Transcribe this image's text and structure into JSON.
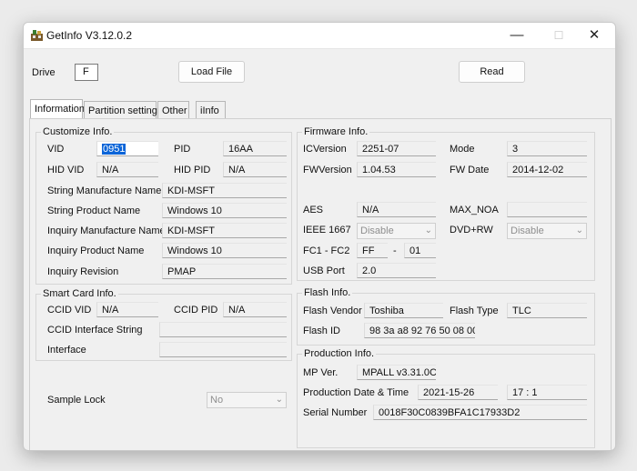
{
  "window": {
    "title": "GetInfo V3.12.0.2",
    "minimize": "—",
    "maximize": "☐",
    "close": "✕"
  },
  "toolbar": {
    "drive_label": "Drive",
    "drive_value": "F",
    "load_file": "Load File",
    "read": "Read"
  },
  "tabs": [
    "Information",
    "Partition setting",
    "Other",
    "iInfo"
  ],
  "customize": {
    "title": "Customize Info.",
    "vid_label": "VID",
    "vid_value": "0951",
    "pid_label": "PID",
    "pid_value": "16AA",
    "hid_vid_label": "HID VID",
    "hid_vid_value": "N/A",
    "hid_pid_label": "HID PID",
    "hid_pid_value": "N/A",
    "str_mfr_label": "String Manufacture Name",
    "str_mfr_value": "KDI-MSFT",
    "str_prod_label": "String Product Name",
    "str_prod_value": "Windows 10",
    "inq_mfr_label": "Inquiry Manufacture Name",
    "inq_mfr_value": "KDI-MSFT",
    "inq_prod_label": "Inquiry Product Name",
    "inq_prod_value": "Windows 10",
    "inq_rev_label": "Inquiry Revision",
    "inq_rev_value": "PMAP"
  },
  "smartcard": {
    "title": "Smart Card Info.",
    "ccid_vid_label": "CCID VID",
    "ccid_vid_value": "N/A",
    "ccid_pid_label": "CCID PID",
    "ccid_pid_value": "N/A",
    "iface_string_label": "CCID Interface String",
    "iface_string_value": "",
    "interface_label": "Interface",
    "interface_value": ""
  },
  "sample_lock": {
    "label": "Sample Lock",
    "value": "No"
  },
  "firmware": {
    "title": "Firmware Info.",
    "icversion_label": "ICVersion",
    "icversion_value": "2251-07",
    "mode_label": "Mode",
    "mode_value": "3",
    "fwversion_label": "FWVersion",
    "fwversion_value": "1.04.53",
    "fwdate_label": "FW Date",
    "fwdate_value": "2014-12-02",
    "aes_label": "AES",
    "aes_value": "N/A",
    "max_noa_label": "MAX_NOA",
    "max_noa_value": "",
    "ieee_label": "IEEE 1667",
    "ieee_value": "Disable",
    "dvd_label": "DVD+RW",
    "dvd_value": "Disable",
    "fc_label": "FC1 - FC2",
    "fc1_value": "FF",
    "fc_sep": "-",
    "fc2_value": "01",
    "usb_label": "USB Port",
    "usb_value": "2.0"
  },
  "flash": {
    "title": "Flash Info.",
    "vendor_label": "Flash Vendor",
    "vendor_value": "Toshiba",
    "type_label": "Flash Type",
    "type_value": "TLC",
    "id_label": "Flash ID",
    "id_value": "98 3a a8 92 76 50 08 00"
  },
  "production": {
    "title": "Production Info.",
    "mp_label": "MP Ver.",
    "mp_value": "MPALL v3.31.0C",
    "date_label": "Production Date & Time",
    "date_value": "2021-15-26",
    "time_value": "17 : 1",
    "serial_label": "Serial Number",
    "serial_value": "0018F30C0839BFA1C17933D2"
  }
}
